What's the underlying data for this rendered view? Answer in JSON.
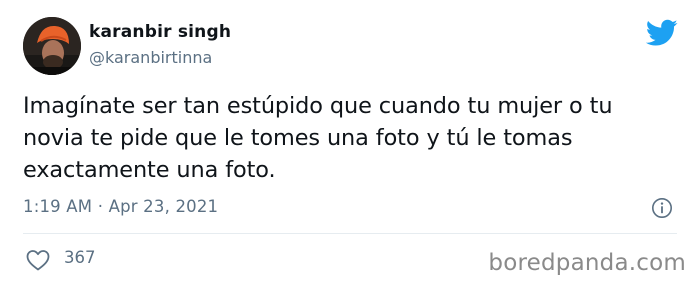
{
  "author": {
    "display_name": "karanbir singh",
    "handle": "@karanbirtinna",
    "avatar_icon": "profile-photo"
  },
  "tweet": {
    "text_lines": [
      "Imagínate ser tan estúpido que cuando tu mujer o tu",
      "novia te pide que le tomes una foto y tú le tomas",
      "exactamente una foto."
    ],
    "time": "1:19 AM",
    "separator": "·",
    "date": "Apr 23, 2021"
  },
  "actions": {
    "likes": "367",
    "like_icon": "heart-icon",
    "info_icon": "info-icon"
  },
  "brand": {
    "icon": "twitter-bird-icon",
    "color": "#1da1f2"
  },
  "watermark": "boredpanda.com",
  "colors": {
    "text": "#0f1419",
    "secondary": "#5b7083",
    "divider": "#e6ecf0"
  }
}
